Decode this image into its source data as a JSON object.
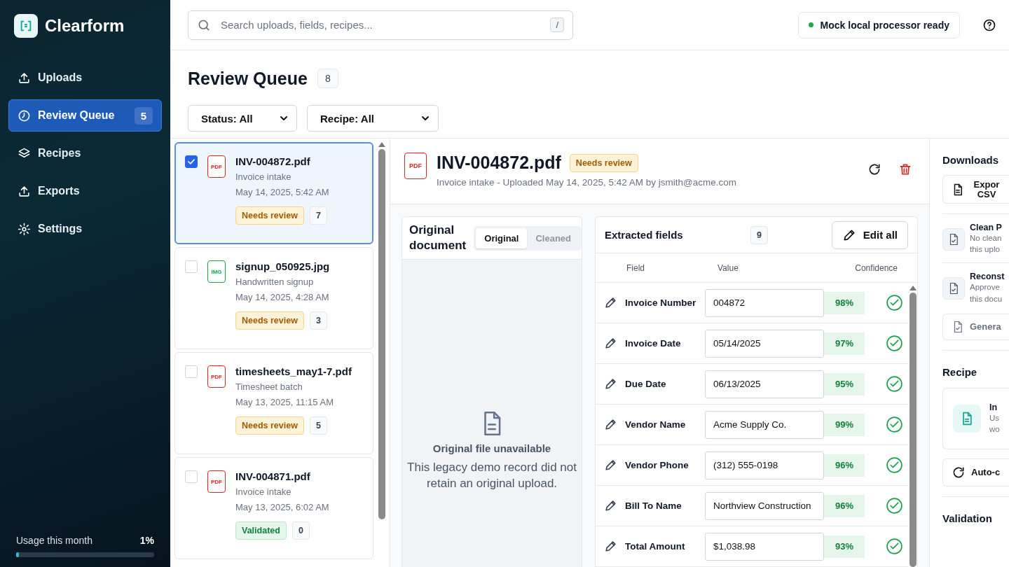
{
  "sidebar": {
    "brand": "Clearform",
    "items": [
      {
        "label": "Uploads",
        "selected": false
      },
      {
        "label": "Review Queue",
        "selected": true,
        "badge": "5"
      },
      {
        "label": "Recipes",
        "selected": false
      },
      {
        "label": "Exports",
        "selected": false
      },
      {
        "label": "Settings",
        "selected": false
      }
    ],
    "usage": {
      "label": "Usage this month",
      "value": "1%",
      "level": 0.01
    }
  },
  "topbar": {
    "search": {
      "placeholder": "Search uploads, fields, recipes...",
      "shortcut": "/"
    },
    "status": "Mock local processor ready"
  },
  "page": {
    "title": "Review Queue",
    "count": "8",
    "filters": [
      "Status: All",
      "Recipe: All"
    ]
  },
  "uploads": [
    {
      "name": "INV-004872.pdf",
      "filetype": "PDF",
      "kind": "pdf",
      "recipe": "Invoice intake",
      "date": "May 14, 2025, 5:42 AM",
      "status": "Needs review",
      "validated": false,
      "count": "7",
      "selected": true
    },
    {
      "name": "signup_050925.jpg",
      "filetype": "IMG",
      "kind": "img",
      "recipe": "Handwritten signup",
      "date": "May 14, 2025, 4:28 AM",
      "status": "Needs review",
      "validated": false,
      "count": "3",
      "selected": false
    },
    {
      "name": "timesheets_may1-7.pdf",
      "filetype": "PDF",
      "kind": "pdf",
      "recipe": "Timesheet batch",
      "date": "May 13, 2025, 11:15 AM",
      "status": "Needs review",
      "validated": false,
      "count": "5",
      "selected": false
    },
    {
      "name": "INV-004871.pdf",
      "filetype": "PDF",
      "kind": "pdf",
      "recipe": "Invoice intake",
      "date": "May 13, 2025, 6:02 AM",
      "status": "Validated",
      "validated": true,
      "count": "0",
      "selected": false
    }
  ],
  "detail": {
    "filetype": "PDF",
    "title": "INV-004872.pdf",
    "status": "Needs review",
    "subtitle": "Invoice intake - Uploaded May 14, 2025, 5:42 AM by jsmith@acme.com",
    "viewer": {
      "title": "Original document",
      "tabs": [
        {
          "label": "Original",
          "selected": true
        },
        {
          "label": "Cleaned",
          "selected": false
        }
      ],
      "empty_title": "Original file unavailable",
      "empty_message": "This legacy demo record did not retain an original upload."
    },
    "fields": {
      "title": "Extracted fields",
      "count": "9",
      "edit_button": "Edit all",
      "columns": [
        "Field",
        "Value",
        "Confidence"
      ],
      "rows": [
        {
          "field": "Invoice Number",
          "value": "004872",
          "confidence": "98%",
          "verified": true
        },
        {
          "field": "Invoice Date",
          "value": "05/14/2025",
          "confidence": "97%",
          "verified": true
        },
        {
          "field": "Due Date",
          "value": "06/13/2025",
          "confidence": "95%",
          "verified": true
        },
        {
          "field": "Vendor Name",
          "value": "Acme Supply Co.",
          "confidence": "99%",
          "verified": true
        },
        {
          "field": "Vendor Phone",
          "value": "(312) 555-0198",
          "confidence": "96%",
          "verified": true
        },
        {
          "field": "Bill To Name",
          "value": "Northview Construction",
          "confidence": "96%",
          "verified": true
        },
        {
          "field": "Total Amount",
          "value": "$1,038.98",
          "confidence": "93%",
          "verified": true
        }
      ]
    }
  },
  "side_panel": {
    "downloads_title": "Downloads",
    "export_button": "Expor CSV",
    "items": [
      {
        "title": "Clean P",
        "desc_1": "No clean",
        "desc_2": "this uplo"
      },
      {
        "title": "Reconst",
        "desc_1": "Approve",
        "desc_2": "this docu"
      }
    ],
    "generate_button": "Genera",
    "recipe_title": "Recipe",
    "recipe_name": "In",
    "recipe_desc_1": "Us",
    "recipe_desc_2": "wo",
    "auto_button": "Auto-c",
    "validation_title": "Validation"
  }
}
